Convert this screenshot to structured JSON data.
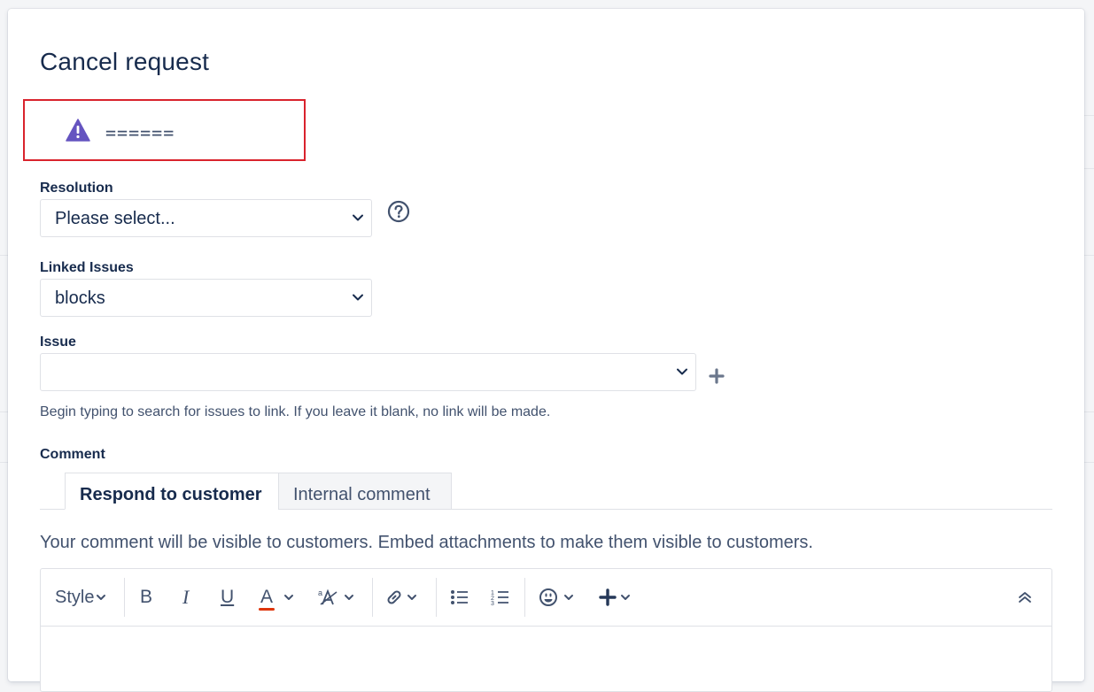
{
  "dialog": {
    "title": "Cancel request",
    "warning": {
      "text": "======",
      "icon": "warning-icon",
      "icon_color": "#6554c0",
      "border_color": "#d9232d"
    }
  },
  "resolution": {
    "label": "Resolution",
    "selected": "Please select...",
    "help_icon": "help-icon"
  },
  "linked_issues": {
    "label": "Linked Issues",
    "selected": "blocks"
  },
  "issue": {
    "label": "Issue",
    "value": "",
    "add_icon": "plus-icon",
    "hint": "Begin typing to search for issues to link. If you leave it blank, no link will be made."
  },
  "comment": {
    "label": "Comment",
    "tabs": [
      {
        "label": "Respond to customer",
        "active": true
      },
      {
        "label": "Internal comment",
        "active": false
      }
    ],
    "visibility_note": "Your comment will be visible to customers. Embed attachments to make them visible to customers.",
    "toolbar": {
      "style_label": "Style",
      "bold": "B",
      "italic": "I",
      "underline": "U",
      "text_color": "A",
      "text_color_accent": "#de350b"
    }
  }
}
